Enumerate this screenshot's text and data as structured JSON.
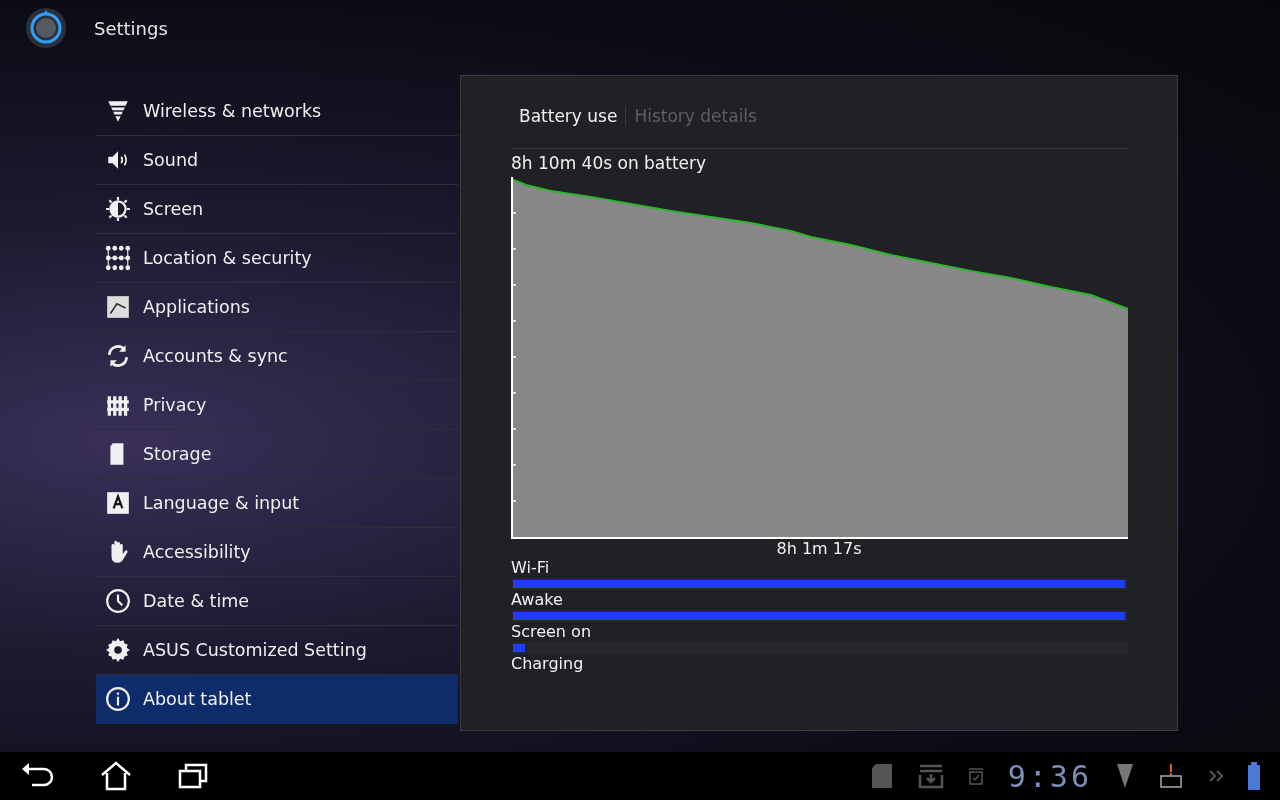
{
  "action_bar": {
    "title": "Settings"
  },
  "menu": [
    {
      "kind": "wireless",
      "label": "Wireless & networks",
      "selected": false
    },
    {
      "kind": "sound",
      "label": "Sound",
      "selected": false
    },
    {
      "kind": "screen",
      "label": "Screen",
      "selected": false
    },
    {
      "kind": "location",
      "label": "Location & security",
      "selected": false
    },
    {
      "kind": "apps",
      "label": "Applications",
      "selected": false
    },
    {
      "kind": "sync",
      "label": "Accounts & sync",
      "selected": false
    },
    {
      "kind": "privacy",
      "label": "Privacy",
      "selected": false
    },
    {
      "kind": "storage",
      "label": "Storage",
      "selected": false
    },
    {
      "kind": "language",
      "label": "Language & input",
      "selected": false
    },
    {
      "kind": "accessibility",
      "label": "Accessibility",
      "selected": false
    },
    {
      "kind": "date",
      "label": "Date & time",
      "selected": false
    },
    {
      "kind": "gear",
      "label": "ASUS Customized Setting",
      "selected": false
    },
    {
      "kind": "info",
      "label": "About tablet",
      "selected": true
    }
  ],
  "panel": {
    "tabs": [
      {
        "label": "Battery use",
        "selected": true
      },
      {
        "label": "History details",
        "selected": false
      }
    ],
    "graph_title": "8h 10m 40s on battery",
    "graph_caption": "8h 1m 17s",
    "signals": [
      {
        "label": "Wi-Fi",
        "level": 1
      },
      {
        "label": "Awake",
        "level": 1
      },
      {
        "label": "Screen on",
        "level": 0.02
      },
      {
        "label": "Charging"
      }
    ]
  },
  "status_bar": {
    "time": "9:36"
  }
}
